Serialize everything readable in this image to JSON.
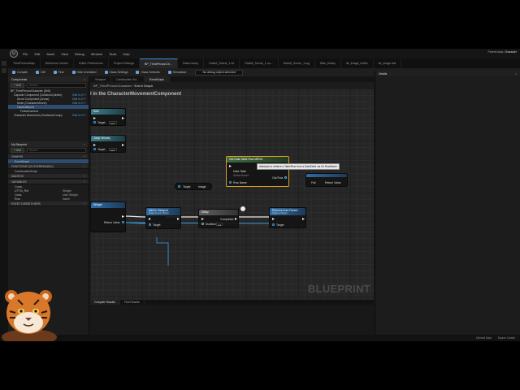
{
  "menu": [
    "File",
    "Edit",
    "Asset",
    "View",
    "Debug",
    "Window",
    "Tools",
    "Help"
  ],
  "doc_tabs": [
    {
      "label": "ThirdPersonMap",
      "active": false
    },
    {
      "label": "Reference Viewer",
      "active": false
    },
    {
      "label": "Editor Preferences",
      "active": false
    },
    {
      "label": "Project Settings",
      "active": false
    },
    {
      "label": "BP_ThirdPersonCh...",
      "active": true
    },
    {
      "label": "DialoLibrary",
      "active": false
    },
    {
      "label": "Dialo5_Scene_1.txt",
      "active": false
    },
    {
      "label": "Dialo5_Scene_1.no...",
      "active": false
    },
    {
      "label": "Dialo5_Scene_1.log",
      "active": false
    },
    {
      "label": "Wan_binary",
      "active": false
    },
    {
      "label": "ds_image_br8dc",
      "active": false
    },
    {
      "label": "ds_image.dat",
      "active": false
    }
  ],
  "top_right": {
    "parent": "Parent class:",
    "cls": "Character"
  },
  "toolbar": {
    "buttons": [
      "Compile",
      "Diff",
      "Find",
      "Hide Unrelated",
      "Class Settings",
      "Class Defaults",
      "Simulation"
    ],
    "debug_filter": "No debug object selected"
  },
  "components": {
    "title": "Components",
    "add": "+ Add",
    "search": "Search",
    "rows": [
      {
        "label": "BP_ThirdPersonCharacter (Self)",
        "edit": "",
        "sel": false,
        "indent": 0
      },
      {
        "label": "Capsule Component (CollisionCylinder)",
        "edit": "Edit in C++",
        "sel": false,
        "indent": 1
      },
      {
        "label": "Arrow Component (Arrow)",
        "edit": "Edit in C++",
        "sel": false,
        "indent": 2
      },
      {
        "label": "Mesh (CharacterMesh0)",
        "edit": "Edit in C++",
        "sel": false,
        "indent": 2
      },
      {
        "label": "CameraBoom",
        "edit": "",
        "sel": true,
        "indent": 2
      },
      {
        "label": "FollowCamera",
        "edit": "",
        "sel": false,
        "indent": 3
      },
      {
        "label": "Character Movement (CharMoveComp)",
        "edit": "Edit in C++",
        "sel": false,
        "indent": 1
      }
    ]
  },
  "my_blueprint": {
    "title": "My Blueprint",
    "add": "+ Add",
    "search": "Search",
    "sections": [
      {
        "name": "GRAPHS",
        "items": [
          "EventGraph"
        ]
      },
      {
        "name": "FUNCTIONS (33 OVERRIDABLE)",
        "items": [
          "ConstructionScript"
        ]
      },
      {
        "name": "MACROS",
        "items": []
      },
      {
        "name": "VARIABLES",
        "items": []
      },
      {
        "name": "EVENT DISPATCHERS",
        "items": []
      }
    ],
    "variables": [
      {
        "name": "Comp...",
        "type": ""
      },
      {
        "name": "UTTUI_Ref",
        "type": "Widget"
      },
      {
        "name": "Class",
        "type": "User Widget"
      },
      {
        "name": "Row",
        "type": "Name"
      }
    ]
  },
  "graph": {
    "tabs": [
      {
        "label": "Viewport",
        "active": false
      },
      {
        "label": "Construction Scr...",
        "active": false
      },
      {
        "label": "EventGraph",
        "active": true
      }
    ],
    "crumb_root": "BP_ThirdPersonCharacter",
    "crumb_leaf": "Event Graph",
    "comment": "l in the CharacterMovementComponent",
    "watermark": "BLUEPRINT",
    "nodes": {
      "n1": {
        "title": "Sets",
        "pin": "Target",
        "val": "self"
      },
      "n2": {
        "title": "Jump Velocity",
        "pin": "Target",
        "val": "self"
      },
      "target": {
        "title": "Target",
        "val": "Image"
      },
      "datatable": {
        "title": "Get Data Table Row MENU",
        "pin1": "Data Table",
        "pin1val": "Select Asset",
        "pin2": "Row Name",
        "outrow": "Out Row"
      },
      "fail": {
        "title": "",
        "pin": "Fail",
        "ret": "Return Value"
      },
      "widget": {
        "title": "Widget",
        "ret": "Return Value"
      },
      "addvp": {
        "title": "Add to Viewport",
        "sub": "Target is User Widget",
        "pin": "Target"
      },
      "delay": {
        "title": "Delay",
        "pin": "Duration",
        "val": "2.0",
        "out": "Completed"
      },
      "remove": {
        "title": "Remove from Parent",
        "sub": "Target is Widget",
        "pin": "Target"
      }
    },
    "tooltip": "Attempts to retrieve a TableRow from a DataTable via it's RowName"
  },
  "bottom_tabs": [
    {
      "label": "Compiler Results",
      "active": true
    },
    {
      "label": "Find Results",
      "active": false
    }
  ],
  "details": {
    "title": "Details"
  },
  "status": {
    "left": "Content Drawer",
    "r1": "Derived Data",
    "r2": "Source Control"
  }
}
